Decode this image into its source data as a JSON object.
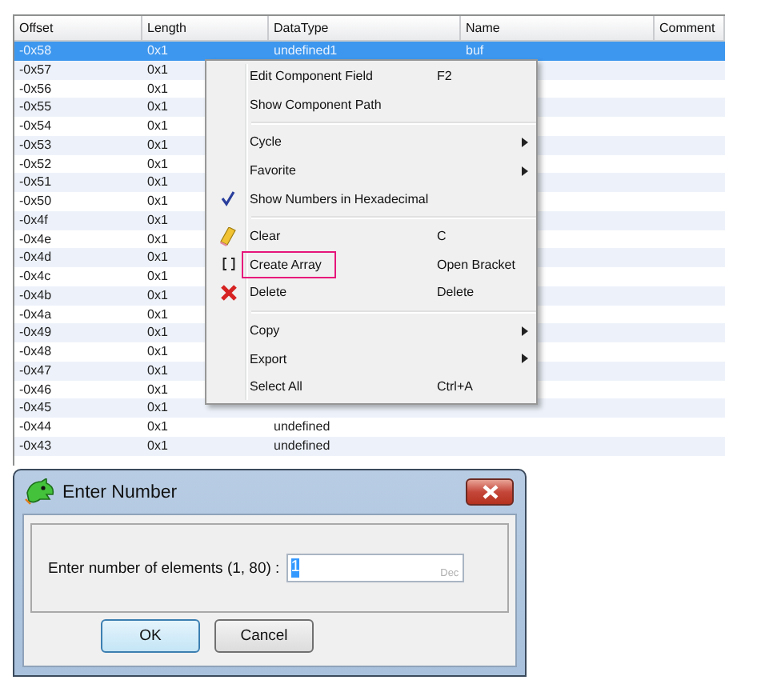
{
  "table": {
    "columns": [
      "Offset",
      "Length",
      "DataType",
      "Name",
      "Comment"
    ],
    "rows": [
      {
        "offset": "-0x58",
        "length": "0x1",
        "datatype": "undefined1",
        "name": "buf",
        "selected": true
      },
      {
        "offset": "-0x57",
        "length": "0x1",
        "selected": false
      },
      {
        "offset": "-0x56",
        "length": "0x1",
        "selected": false
      },
      {
        "offset": "-0x55",
        "length": "0x1",
        "selected": false
      },
      {
        "offset": "-0x54",
        "length": "0x1",
        "selected": false
      },
      {
        "offset": "-0x53",
        "length": "0x1",
        "selected": false
      },
      {
        "offset": "-0x52",
        "length": "0x1",
        "selected": false
      },
      {
        "offset": "-0x51",
        "length": "0x1",
        "selected": false
      },
      {
        "offset": "-0x50",
        "length": "0x1",
        "selected": false
      },
      {
        "offset": "-0x4f",
        "length": "0x1",
        "selected": false
      },
      {
        "offset": "-0x4e",
        "length": "0x1",
        "selected": false
      },
      {
        "offset": "-0x4d",
        "length": "0x1",
        "selected": false
      },
      {
        "offset": "-0x4c",
        "length": "0x1",
        "selected": false
      },
      {
        "offset": "-0x4b",
        "length": "0x1",
        "selected": false
      },
      {
        "offset": "-0x4a",
        "length": "0x1",
        "selected": false
      },
      {
        "offset": "-0x49",
        "length": "0x1",
        "selected": false
      },
      {
        "offset": "-0x48",
        "length": "0x1",
        "selected": false
      },
      {
        "offset": "-0x47",
        "length": "0x1",
        "selected": false
      },
      {
        "offset": "-0x46",
        "length": "0x1",
        "selected": false
      },
      {
        "offset": "-0x45",
        "length": "0x1",
        "selected": false
      },
      {
        "offset": "-0x44",
        "length": "0x1",
        "datatype": "undefined",
        "selected": false
      },
      {
        "offset": "-0x43",
        "length": "0x1",
        "datatype": "undefined",
        "selected": false
      }
    ]
  },
  "context_menu": {
    "items": [
      {
        "kind": "item",
        "label": "Edit Component Field",
        "shortcut": "F2",
        "submenu": false,
        "checked": false,
        "highlighted": false
      },
      {
        "kind": "item",
        "label": "Show Component Path",
        "submenu": false,
        "checked": false,
        "highlighted": false
      },
      {
        "kind": "separator"
      },
      {
        "kind": "item",
        "label": "Cycle",
        "submenu": true,
        "checked": false,
        "highlighted": false
      },
      {
        "kind": "item",
        "label": "Favorite",
        "submenu": true,
        "checked": false,
        "highlighted": false
      },
      {
        "kind": "item",
        "label": "Show Numbers in Hexadecimal",
        "submenu": false,
        "checked": true,
        "highlighted": false
      },
      {
        "kind": "separator"
      },
      {
        "kind": "item",
        "label": "Clear",
        "shortcut": "C",
        "submenu": false,
        "checked": false,
        "highlighted": false
      },
      {
        "kind": "item",
        "label": "Create Array",
        "shortcut": "Open Bracket",
        "submenu": false,
        "checked": false,
        "highlighted": true
      },
      {
        "kind": "item",
        "label": "Delete",
        "shortcut": "Delete",
        "submenu": false,
        "checked": false,
        "highlighted": false
      },
      {
        "kind": "separator"
      },
      {
        "kind": "item",
        "label": "Copy",
        "submenu": true,
        "checked": false,
        "highlighted": false
      },
      {
        "kind": "item",
        "label": "Export",
        "submenu": true,
        "checked": false,
        "highlighted": false
      },
      {
        "kind": "item",
        "label": "Select All",
        "shortcut": "Ctrl+A",
        "submenu": false,
        "checked": false,
        "highlighted": false
      }
    ]
  },
  "dialog": {
    "title": "Enter Number",
    "prompt": "Enter number of elements (1, 80) :",
    "value": "1",
    "value_selected": true,
    "radix": "Dec",
    "buttons": [
      {
        "label": "OK",
        "default": true
      },
      {
        "label": "Cancel",
        "default": false
      }
    ]
  }
}
